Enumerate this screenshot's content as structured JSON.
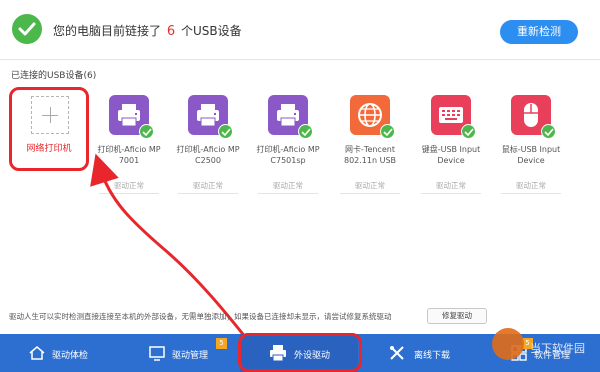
{
  "header": {
    "msg_before": "您的电脑目前链接了",
    "usb_count": "6",
    "msg_after": "个USB设备",
    "rescan_label": "重新检测"
  },
  "section": {
    "title": "已连接的USB设备(6)"
  },
  "add_card": {
    "label": "网络打印机"
  },
  "devices": [
    {
      "name_l1": "打印机-Aficio MP",
      "name_l2": "7001",
      "status": "驱动正常",
      "icon": "printer-icon",
      "color": "#8b59c7"
    },
    {
      "name_l1": "打印机-Aficio MP",
      "name_l2": "C2500",
      "status": "驱动正常",
      "icon": "printer-icon",
      "color": "#8b59c7"
    },
    {
      "name_l1": "打印机-Aficio MP",
      "name_l2": "C7501sp",
      "status": "驱动正常",
      "icon": "printer-icon",
      "color": "#8b59c7"
    },
    {
      "name_l1": "网卡-Tencent",
      "name_l2": "802.11n USB",
      "status": "驱动正常",
      "icon": "globe-icon",
      "color": "#f26a3a"
    },
    {
      "name_l1": "键盘-USB Input",
      "name_l2": "Device",
      "status": "驱动正常",
      "icon": "keyboard-icon",
      "color": "#e8405a"
    },
    {
      "name_l1": "鼠标-USB Input",
      "name_l2": "Device",
      "status": "驱动正常",
      "icon": "mouse-icon",
      "color": "#e8405a"
    }
  ],
  "info": {
    "text": "驱动人生可以实时检测直接连接至本机的外部设备，无需单独添加；如果设备已连接却未显示，请尝试修复系统驱动",
    "repair_label": "修复驱动"
  },
  "nav": {
    "items": [
      {
        "label": "驱动体检",
        "icon": "home-icon"
      },
      {
        "label": "驱动管理",
        "icon": "monitor-icon",
        "badge": "5"
      },
      {
        "label": "外设驱动",
        "icon": "printer-icon",
        "active": true
      },
      {
        "label": "离线下载",
        "icon": "tools-icon"
      },
      {
        "label": "软件管理",
        "icon": "grid-icon",
        "badge": "5"
      }
    ]
  },
  "watermark": {
    "text": "当下软件园"
  },
  "colors": {
    "accent": "#2c8ef0",
    "bottom_bar": "#2d6fd1",
    "highlight": "#e8262b",
    "ok_green": "#4cb84c",
    "device_purple": "#8b59c7",
    "device_orange": "#f26a3a",
    "device_pink": "#e8405a"
  }
}
